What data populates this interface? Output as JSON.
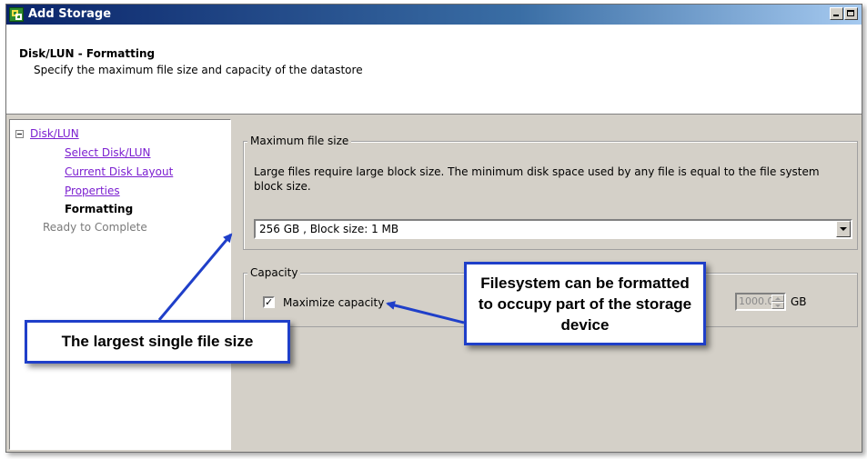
{
  "window": {
    "title": "Add Storage",
    "icon": "add-storage-icon"
  },
  "header": {
    "title": "Disk/LUN - Formatting",
    "subtitle": "Specify the maximum file size and capacity of the datastore"
  },
  "nav": {
    "root": "Disk/LUN",
    "items": [
      {
        "label": "Select Disk/LUN",
        "state": "link"
      },
      {
        "label": "Current Disk Layout",
        "state": "link"
      },
      {
        "label": "Properties",
        "state": "link"
      },
      {
        "label": "Formatting",
        "state": "current"
      },
      {
        "label": "Ready to Complete",
        "state": "disabled"
      }
    ]
  },
  "max_file_size": {
    "legend": "Maximum file size",
    "description": "Large files require large block size.  The minimum disk space used by any file is equal to the file system block size.",
    "selected": "256 GB  ,  Block size: 1 MB"
  },
  "capacity": {
    "legend": "Capacity",
    "checkbox_label": "Maximize capacity",
    "checked": true,
    "value": "1000.00",
    "unit": "GB"
  },
  "callouts": {
    "file_size": "The largest single file size",
    "filesystem": "Filesystem can be formatted to occupy part of the storage device"
  },
  "colors": {
    "callout_border": "#1f3fc9",
    "link": "#7b1fd0",
    "dialog_bg": "#d4d0c8"
  }
}
